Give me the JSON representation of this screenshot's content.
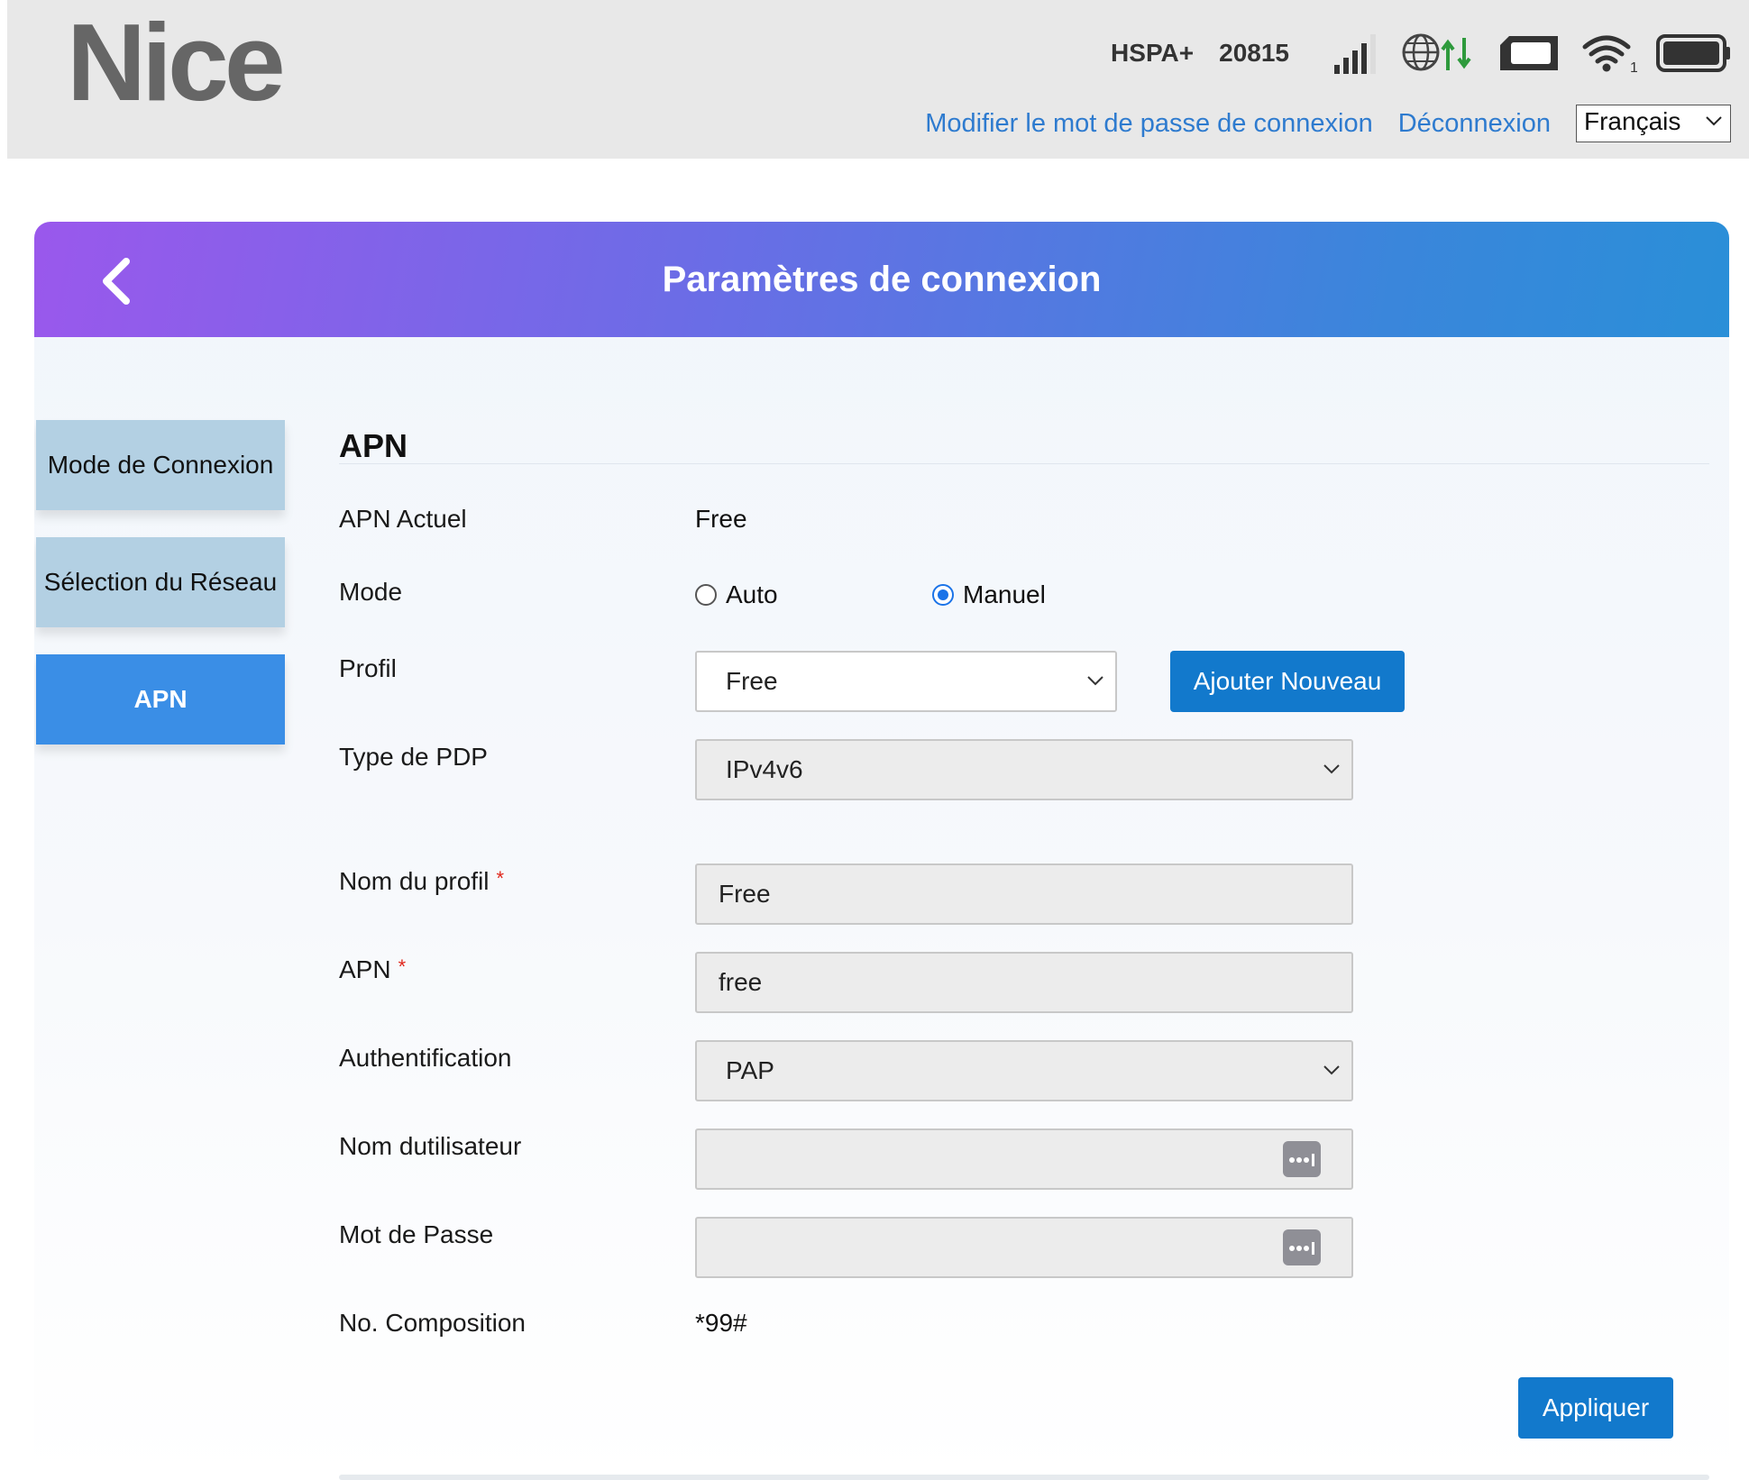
{
  "header": {
    "logo": "Nice",
    "network_type": "HSPA+",
    "operator_code": "20815",
    "icons": [
      "signal-bars-icon",
      "globe-data-icon",
      "sim-card-icon",
      "wifi-icon",
      "battery-icon"
    ],
    "wifi_clients": "1",
    "links": {
      "change_password": "Modifier le mot de passe de connexion",
      "logout": "Déconnexion"
    },
    "language": "Français"
  },
  "banner": {
    "title": "Paramètres de connexion"
  },
  "sidebar": {
    "items": [
      {
        "label": "Mode de Connexion",
        "active": false
      },
      {
        "label": "Sélection du Réseau",
        "active": false
      },
      {
        "label": "APN",
        "active": true
      }
    ]
  },
  "form": {
    "section_title": "APN",
    "current_apn": {
      "label": "APN Actuel",
      "value": "Free"
    },
    "mode": {
      "label": "Mode",
      "options": [
        "Auto",
        "Manuel"
      ],
      "selected": "Manuel"
    },
    "profile": {
      "label": "Profil",
      "value": "Free",
      "add_button": "Ajouter Nouveau"
    },
    "pdp_type": {
      "label": "Type de PDP",
      "value": "IPv4v6"
    },
    "profile_name": {
      "label": "Nom du profil",
      "value": "Free",
      "required_mark": "*"
    },
    "apn": {
      "label": "APN",
      "value": "free",
      "required_mark": "*"
    },
    "authentication": {
      "label": "Authentification",
      "value": "PAP"
    },
    "username": {
      "label": "Nom dutilisateur",
      "value": ""
    },
    "password": {
      "label": "Mot de Passe",
      "value": ""
    },
    "dial_number": {
      "label": "No. Composition",
      "value": "*99#"
    },
    "apply_button": "Appliquer"
  },
  "colors": {
    "link": "#2e7bcf",
    "button": "#1279cc",
    "sidebar_active": "#3a8ee6",
    "sidebar_inactive": "#b3d0e3",
    "banner_start": "#9a58ec",
    "banner_end": "#2a8fd8",
    "required": "#e0261b",
    "data_arrows": "#2e9a3c"
  }
}
